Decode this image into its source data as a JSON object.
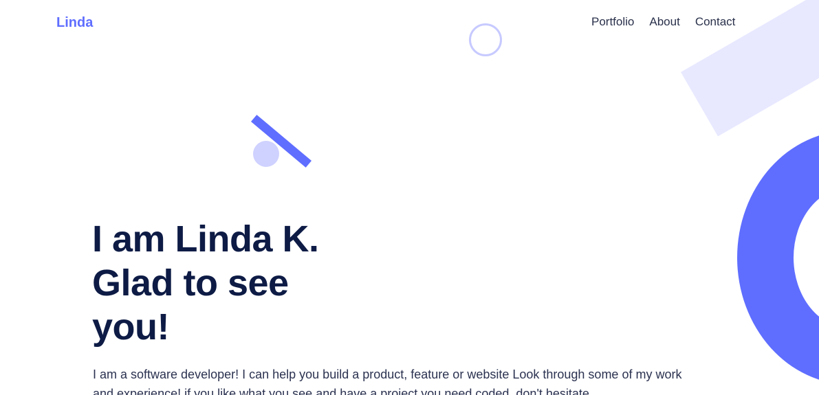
{
  "header": {
    "logo": "Linda",
    "nav": {
      "portfolio": "Portfolio",
      "about": "About",
      "contact": "Contact"
    }
  },
  "hero": {
    "title_line_1": "I am Linda K.",
    "title_line_2": "Glad to see",
    "title_line_3": "you!",
    "description": "I am a software developer! I can help you build a product, feature or website Look through some of my work and experience! if you like what you see and have a project you need coded, don't hesitate"
  },
  "colors": {
    "brand": "#5f6eff",
    "brand_soft": "#cfd1ff",
    "brand_faint": "#e8e9ff",
    "heading": "#0d1b45",
    "text": "#2b3250"
  }
}
